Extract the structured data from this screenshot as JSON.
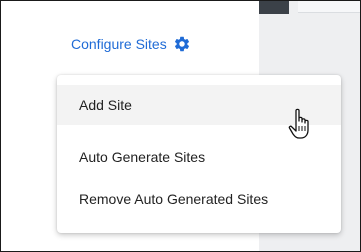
{
  "header": {
    "configure_label": "Configure Sites",
    "configure_icon": "gear-icon",
    "accent_color": "#1f6bd6"
  },
  "menu": {
    "items": [
      {
        "label": "Add Site"
      },
      {
        "label": "Auto Generate Sites"
      },
      {
        "label": "Remove Auto Generated Sites"
      }
    ]
  },
  "cursor": {
    "icon": "hand-pointer-icon"
  }
}
